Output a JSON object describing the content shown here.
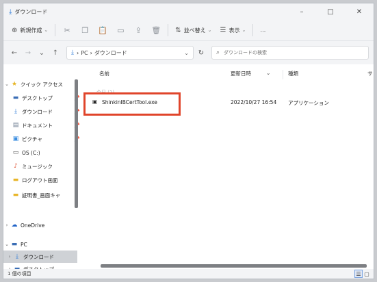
{
  "window": {
    "title": "ダウンロード",
    "controls": [
      "–",
      "□",
      "✕"
    ]
  },
  "commandbar": {
    "new_label": "新規作成",
    "sort_label": "並べ替え",
    "view_label": "表示",
    "more_label": "…"
  },
  "address": {
    "crumbs": [
      "PC",
      "ダウンロード"
    ],
    "search_placeholder": "ダウンロードの検索"
  },
  "sidebar": {
    "items": [
      {
        "label": "クイック アクセス"
      },
      {
        "label": "デスクトップ"
      },
      {
        "label": "ダウンロード"
      },
      {
        "label": "ドキュメント"
      },
      {
        "label": "ピクチャ"
      },
      {
        "label": "OS (C:)"
      },
      {
        "label": "ミュージック"
      },
      {
        "label": "ログアウト画面"
      },
      {
        "label": "証明書_画面キャ"
      },
      {
        "label": "OneDrive"
      },
      {
        "label": "PC"
      },
      {
        "label": "ダウンロード"
      },
      {
        "label": "デスクトップ"
      }
    ]
  },
  "columns": {
    "name": "名前",
    "modified": "更新日時",
    "type": "種類",
    "size": "サ"
  },
  "group_header": "今日 (1)",
  "files": [
    {
      "name": "ShinkinIBCertTool.exe",
      "modified": "2022/10/27 16:54",
      "type": "アプリケーション"
    }
  ],
  "status": {
    "count": "1 個の項目"
  },
  "colors": {
    "accent": "#2d7bd8",
    "highlight_box": "#e0452b"
  }
}
